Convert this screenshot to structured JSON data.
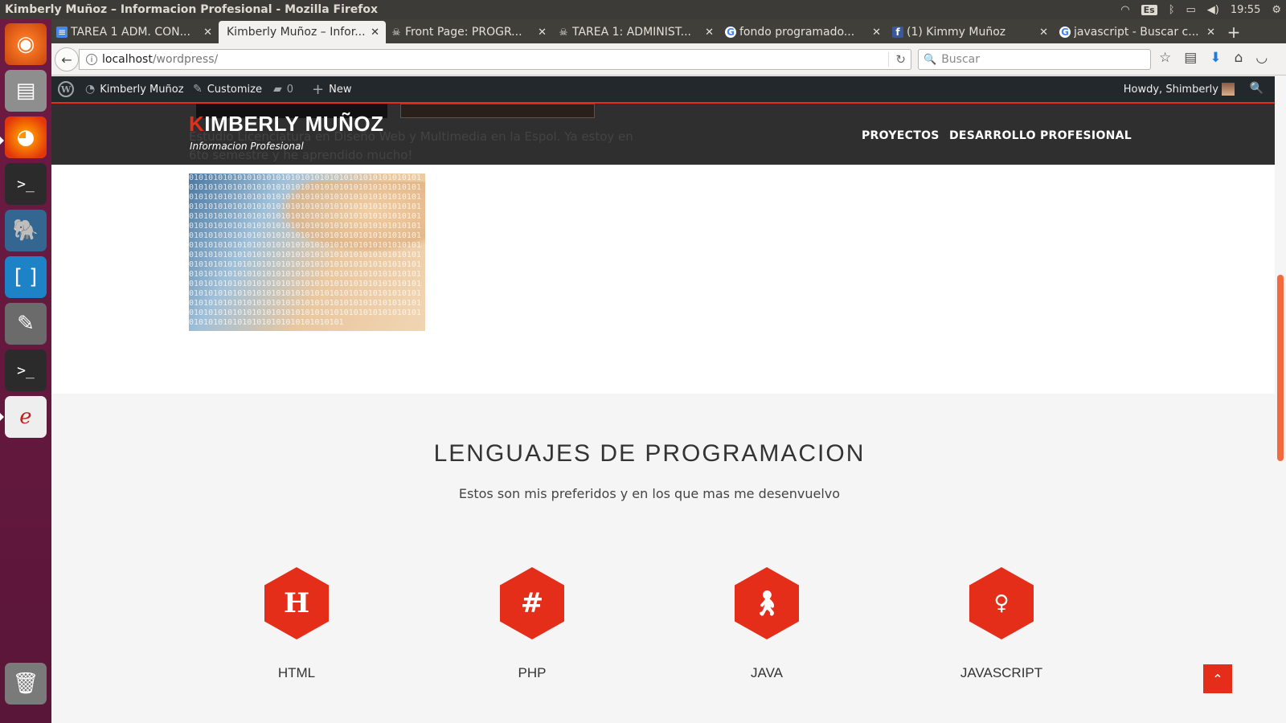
{
  "window": {
    "title": "Kimberly Muñoz – Informacion Profesional - Mozilla Firefox",
    "time": "19:55",
    "keyboard": "Es"
  },
  "tabs": [
    {
      "label": "TAREA 1 ADM. CON...",
      "icon": "docs-icon",
      "active": false
    },
    {
      "label": "Kimberly Muñoz – Infor...",
      "icon": "",
      "active": true
    },
    {
      "label": "Front Page: PROGR...",
      "icon": "ghost-icon",
      "active": false
    },
    {
      "label": "TAREA 1: ADMINIST...",
      "icon": "ghost-icon",
      "active": false
    },
    {
      "label": "fondo programado...",
      "icon": "google-icon",
      "active": false
    },
    {
      "label": "(1) Kimmy Muñoz",
      "icon": "facebook-icon",
      "active": false
    },
    {
      "label": "javascript - Buscar c...",
      "icon": "google-icon",
      "active": false
    }
  ],
  "navbar": {
    "url_host": "localhost",
    "url_path": "/wordpress/",
    "search_placeholder": "Buscar"
  },
  "wpadmin": {
    "site_name": "Kimberly Muñoz",
    "customize": "Customize",
    "comments": "0",
    "new": "New",
    "howdy": "Howdy, Shimberly"
  },
  "site": {
    "title_first": "K",
    "title_rest": "IMBERLY MUÑOZ",
    "tagline": "Informacion Profesional",
    "menu": [
      "PROYECTOS",
      "DESARROLLO PROFESIONAL"
    ],
    "about_text": "Estudio Licenciatura en Diseño Web y Multimedia en la Espol. Ya estoy en 6to semestre y he aprendido mucho!"
  },
  "languages": {
    "title": "LENGUAJES DE PROGRAMACION",
    "subtitle": "Estos son mis preferidos y en los que mas me desenvuelvo",
    "items": [
      {
        "name": "HTML",
        "glyph": "H",
        "icon": "h-icon"
      },
      {
        "name": "PHP",
        "glyph": "#",
        "icon": "hash-icon"
      },
      {
        "name": "JAVA",
        "glyph": "♿",
        "icon": "person-icon"
      },
      {
        "name": "JAVASCRIPT",
        "glyph": "ok",
        "icon": "odnoklassniki-icon"
      }
    ]
  },
  "colors": {
    "accent": "#e52e1a",
    "launcher": "#6e1b44",
    "header": "#2f2f2f",
    "adminbar": "#23282d"
  }
}
